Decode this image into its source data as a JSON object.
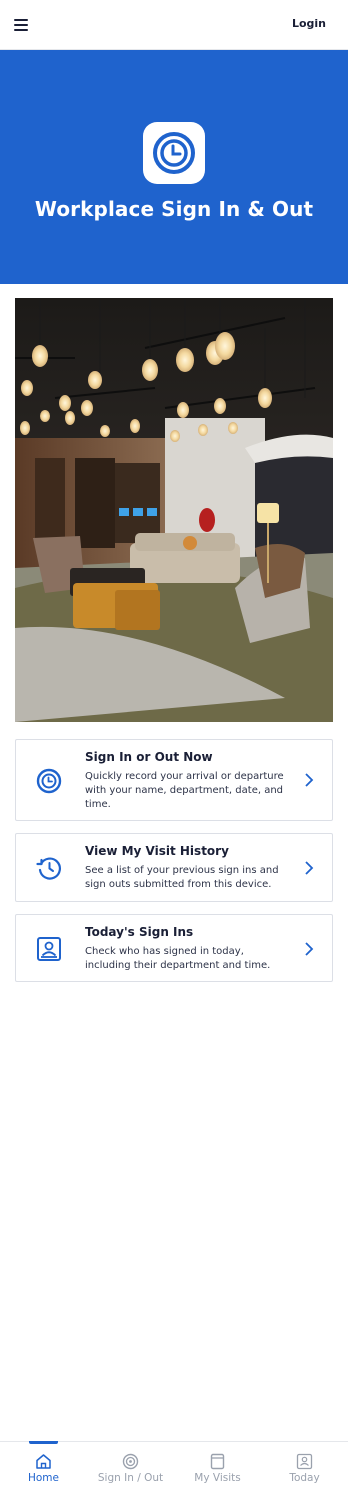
{
  "header": {
    "login_label": "Login"
  },
  "hero": {
    "title": "Workplace Sign In & Out"
  },
  "cards": [
    {
      "title": "Sign In or Out Now",
      "description": "Quickly record your arrival or departure with your name, department, date, and time."
    },
    {
      "title": "View My Visit History",
      "description": "See a list of your previous sign ins and sign outs submitted from this device."
    },
    {
      "title": "Today's Sign Ins",
      "description": "Check who has signed in today, including their department and time."
    }
  ],
  "tabs": [
    {
      "label": "Home",
      "icon": "home-icon",
      "active": true
    },
    {
      "label": "Sign In / Out",
      "icon": "target-icon",
      "active": false
    },
    {
      "label": "My Visits",
      "icon": "page-icon",
      "active": false
    },
    {
      "label": "Today",
      "icon": "person-card-icon",
      "active": false
    }
  ],
  "colors": {
    "brand": "#1f63cd",
    "text": "#1a1f36",
    "muted": "#9aa1ad"
  }
}
